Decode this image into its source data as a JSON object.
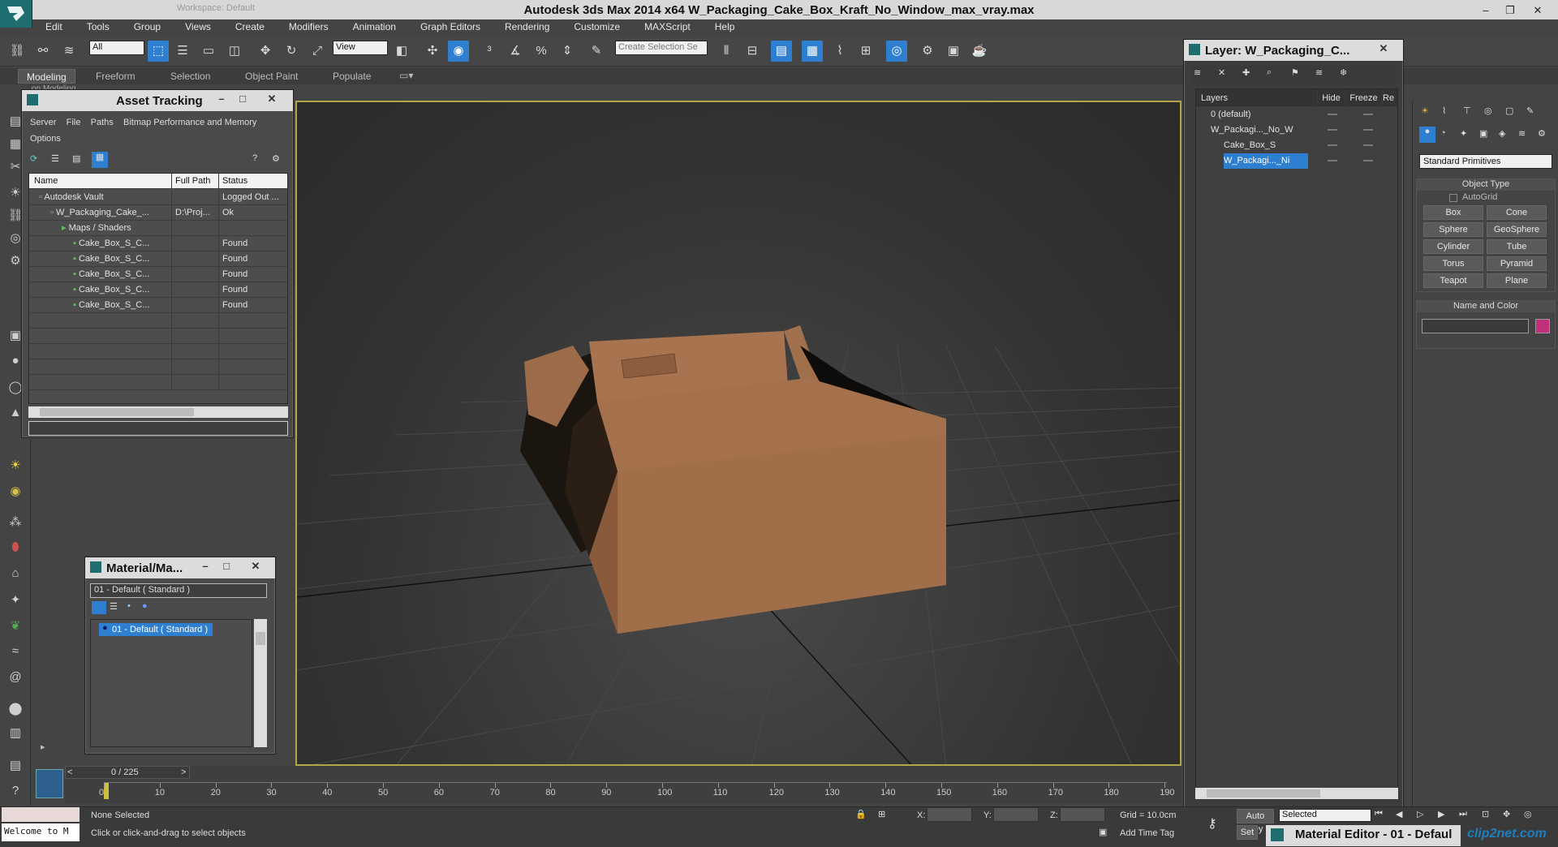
{
  "app": {
    "title": "Autodesk 3ds Max  2014 x64     W_Packaging_Cake_Box_Kraft_No_Window_max_vray.max",
    "workspace": "Workspace: Default"
  },
  "menu": [
    "Edit",
    "Tools",
    "Group",
    "Views",
    "Create",
    "Modifiers",
    "Animation",
    "Graph Editors",
    "Rendering",
    "Customize",
    "MAXScript",
    "Help"
  ],
  "toolbar": {
    "filter_value": "All",
    "view_value": "View",
    "selection_set_placeholder": "Create Selection Se"
  },
  "ribbon": {
    "tabs": [
      "Modeling",
      "Freeform",
      "Selection",
      "Object Paint",
      "Populate"
    ],
    "sub": "Polygon Modeling"
  },
  "asset_tracking": {
    "title": "Asset Tracking",
    "menu": [
      "Server",
      "File",
      "Paths",
      "Bitmap Performance and Memory",
      "Options"
    ],
    "columns": [
      "Name",
      "Full Path",
      "Status"
    ],
    "rows": [
      {
        "name": "Autodesk Vault",
        "path": "",
        "status": "Logged Out ...",
        "indent": 0
      },
      {
        "name": "W_Packaging_Cake_...",
        "path": "D:\\Proj...",
        "status": "Ok",
        "indent": 1
      },
      {
        "name": "Maps / Shaders",
        "path": "",
        "status": "",
        "indent": 2
      },
      {
        "name": "Cake_Box_S_C...",
        "path": "",
        "status": "Found",
        "indent": 3
      },
      {
        "name": "Cake_Box_S_C...",
        "path": "",
        "status": "Found",
        "indent": 3
      },
      {
        "name": "Cake_Box_S_C...",
        "path": "",
        "status": "Found",
        "indent": 3
      },
      {
        "name": "Cake_Box_S_C...",
        "path": "",
        "status": "Found",
        "indent": 3
      },
      {
        "name": "Cake_Box_S_C...",
        "path": "",
        "status": "Found",
        "indent": 3
      }
    ]
  },
  "material_map": {
    "title": "Material/Ma...",
    "field_value": "01 - Default  ( Standard )",
    "list_item": "01 - Default  ( Standard )"
  },
  "layer_window": {
    "title": "Layer: W_Packaging_C...",
    "columns": [
      "Layers",
      "Hide",
      "Freeze",
      "Re"
    ],
    "rows": [
      {
        "name": "0 (default)",
        "indent": 0
      },
      {
        "name": "W_Packagi..._No_W",
        "indent": 0
      },
      {
        "name": "Cake_Box_S",
        "indent": 1
      },
      {
        "name": "W_Packagi..._Ni",
        "indent": 1
      }
    ]
  },
  "command_panel": {
    "category": "Standard Primitives",
    "object_type_header": "Object Type",
    "autogrid_label": "AutoGrid",
    "buttons": [
      "Box",
      "Cone",
      "Sphere",
      "GeoSphere",
      "Cylinder",
      "Tube",
      "Torus",
      "Pyramid",
      "Teapot",
      "Plane"
    ],
    "name_color_header": "Name and Color",
    "object_color": "#c2307a"
  },
  "timeline": {
    "frame_counter": "0 / 225",
    "ticks": [
      "0",
      "10",
      "20",
      "30",
      "40",
      "50",
      "60",
      "70",
      "80",
      "90",
      "100",
      "110",
      "120",
      "130",
      "140",
      "150",
      "160",
      "170",
      "180",
      "190"
    ]
  },
  "status": {
    "script_listener": "Welcome to M",
    "selection": "None Selected",
    "prompt": "Click or click-and-drag to select objects",
    "x_label": "X:",
    "y_label": "Y:",
    "z_label": "Z:",
    "grid": "Grid = 10.0cm",
    "add_time_tag": "Add Time Tag",
    "auto_key": "Auto Key",
    "selected_value": "Selected",
    "set_key": "Set",
    "material_editor_tab": "Material Editor - 01 - Defaul",
    "watermark": "clip2net.com"
  }
}
